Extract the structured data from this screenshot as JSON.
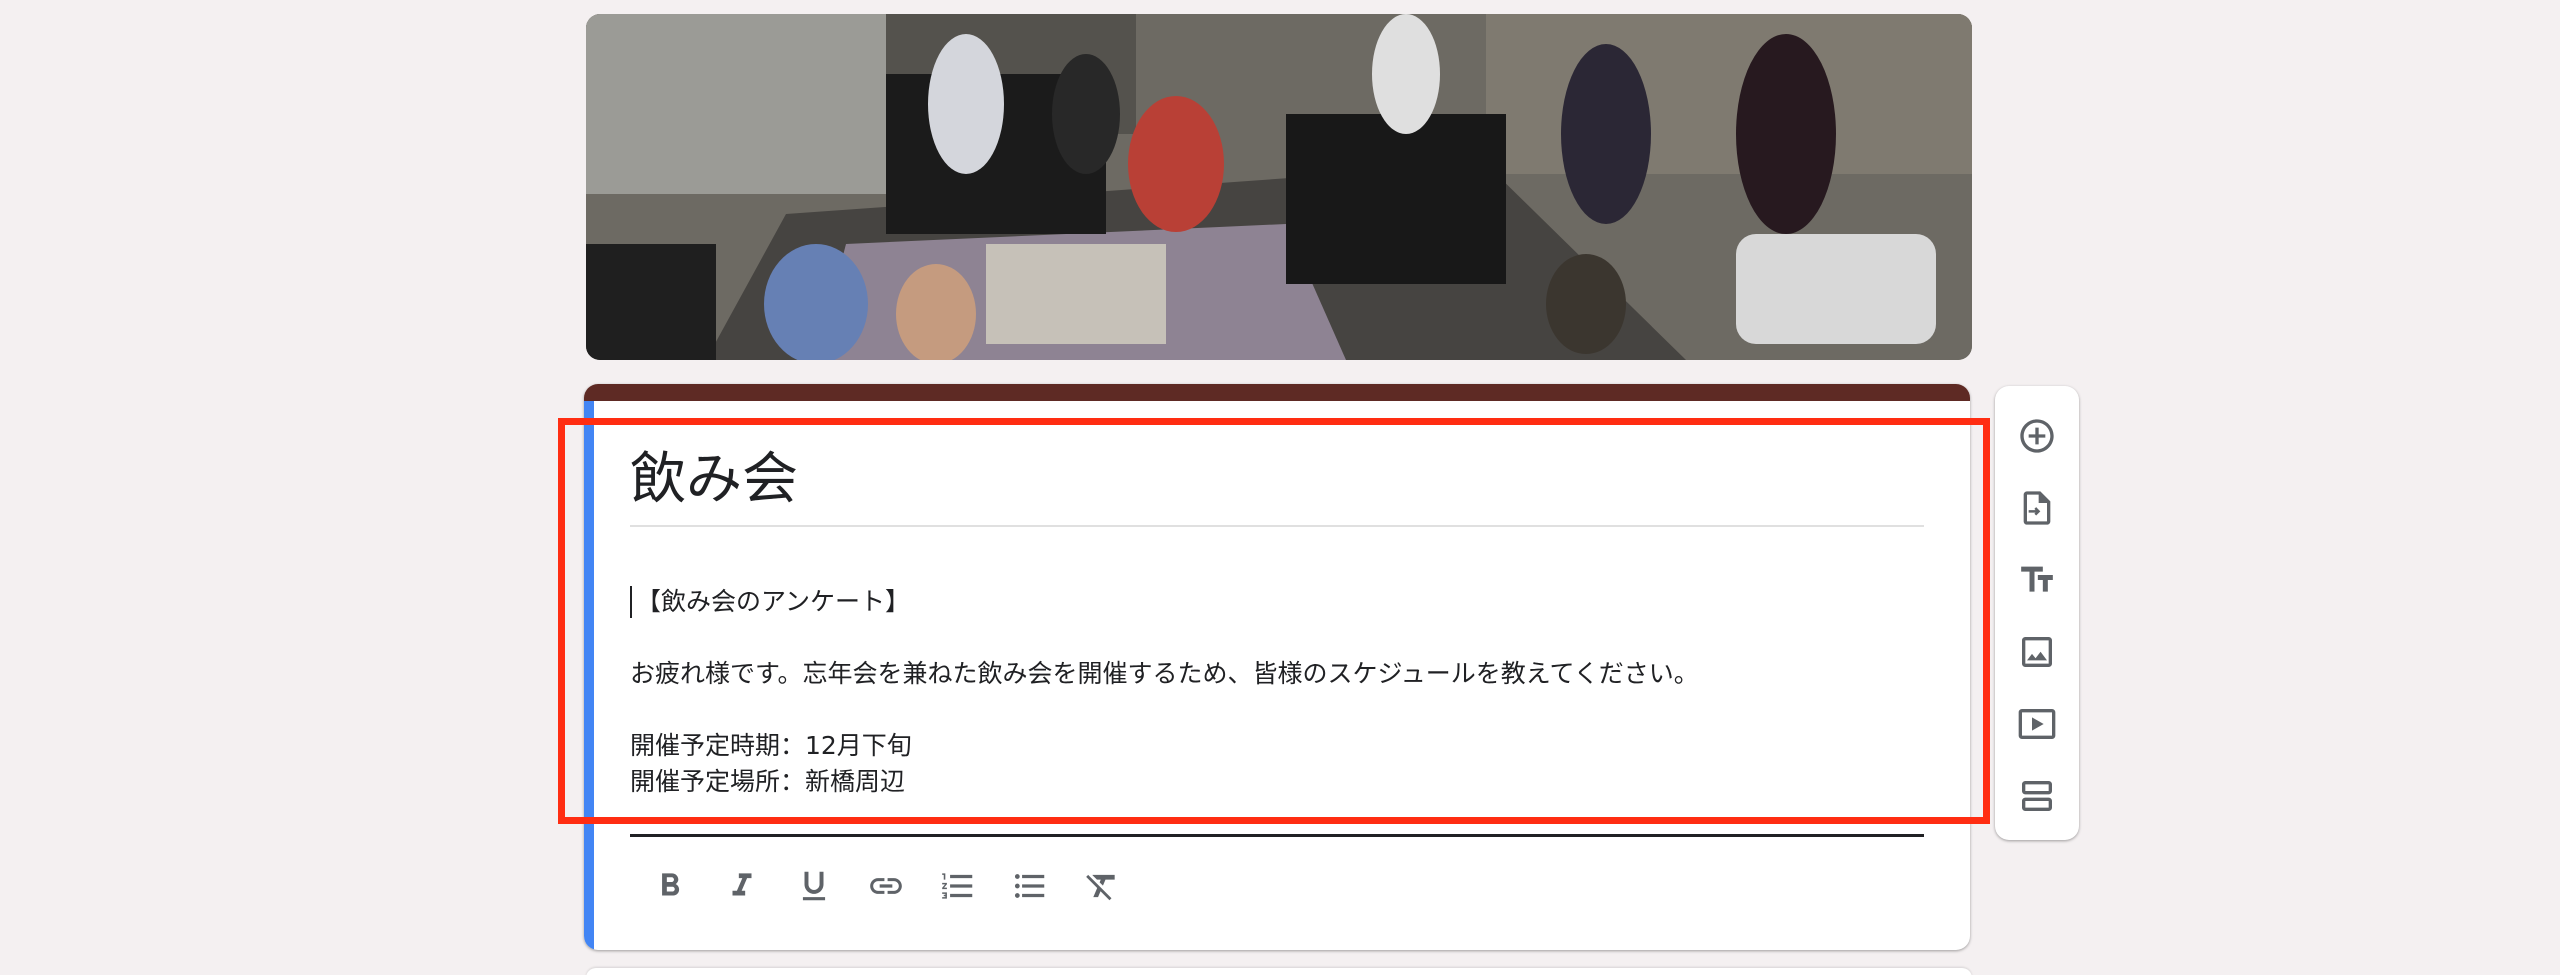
{
  "form": {
    "title": "飲み会",
    "description_lines": [
      "【飲み会のアンケート】",
      "お疲れ様です。忘年会を兼ねた飲み会を開催するため、皆様のスケジュールを教えてください。",
      "開催予定時期：12月下旬",
      "開催予定場所：新橋周辺"
    ]
  },
  "header_image": {
    "description": "party photo"
  },
  "format_toolbar": [
    {
      "icon": "bold-icon"
    },
    {
      "icon": "italic-icon"
    },
    {
      "icon": "underline-icon"
    },
    {
      "icon": "link-icon"
    },
    {
      "icon": "numbered-list-icon"
    },
    {
      "icon": "bulleted-list-icon"
    },
    {
      "icon": "clear-formatting-icon"
    }
  ],
  "side_toolbar": [
    {
      "icon": "add-question-icon"
    },
    {
      "icon": "import-questions-icon"
    },
    {
      "icon": "add-title-icon"
    },
    {
      "icon": "add-image-icon"
    },
    {
      "icon": "add-video-icon"
    },
    {
      "icon": "add-section-icon"
    }
  ],
  "colors": {
    "theme_band": "#5e2a24",
    "focus_bar": "#4285f4",
    "highlight": "#ff2d12",
    "background": "#f4f0f1"
  }
}
